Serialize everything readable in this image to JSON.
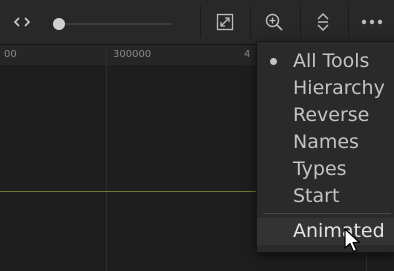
{
  "toolbar": {
    "code_icon": "code-brackets-icon",
    "zoom_slider_position": 0.05,
    "fit_icon": "fit-view-icon",
    "zoom_icon": "zoom-in-icon",
    "expand_icon": "expand-vertical-icon",
    "more_icon": "more-options-icon"
  },
  "ruler": {
    "labels": [
      "00",
      "300000",
      "4"
    ]
  },
  "graph": {
    "curve_color": "#747a2e"
  },
  "menu": {
    "items": [
      {
        "label": "All Tools",
        "selected": true
      },
      {
        "label": "Hierarchy",
        "selected": false
      },
      {
        "label": "Reverse",
        "selected": false
      },
      {
        "label": "Names",
        "selected": false
      },
      {
        "label": "Types",
        "selected": false
      },
      {
        "label": "Start",
        "selected": false
      }
    ],
    "footer_item": {
      "label": "Animated",
      "hovered": true
    }
  }
}
